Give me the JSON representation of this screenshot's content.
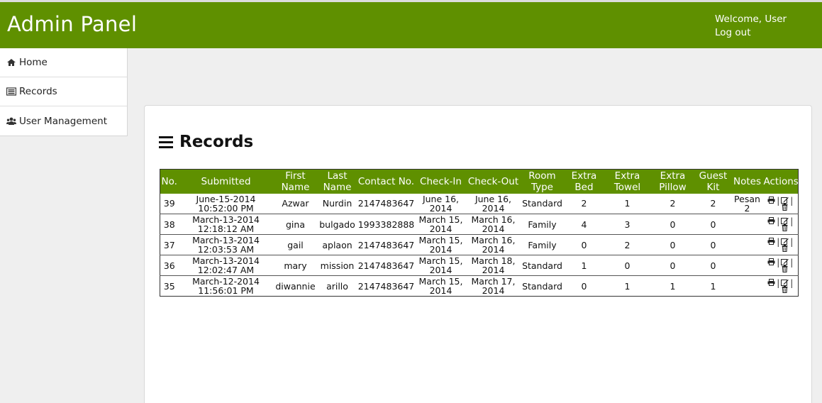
{
  "header": {
    "title": "Admin Panel",
    "welcome": "Welcome, User",
    "logout": "Log out"
  },
  "sidebar": {
    "items": [
      {
        "label": "Home",
        "icon": "home-icon"
      },
      {
        "label": "Records",
        "icon": "list-icon"
      },
      {
        "label": "User Management",
        "icon": "users-icon"
      }
    ]
  },
  "main": {
    "title": "Records"
  },
  "table": {
    "headers": [
      "No.",
      "Submitted",
      "First Name",
      "Last Name",
      "Contact No.",
      "Check-In",
      "Check-Out",
      "Room Type",
      "Extra Bed",
      "Extra Towel",
      "Extra Pillow",
      "Guest Kit",
      "Notes",
      "Actions"
    ],
    "rows": [
      {
        "no": "39",
        "submitted_date": "June-15-2014",
        "submitted_time": "10:52:00 PM",
        "first": "Azwar",
        "last": "Nurdin",
        "contact": "2147483647",
        "checkin": "June 16, 2014",
        "checkout": "June 16, 2014",
        "room": "Standard",
        "bed": "2",
        "towel": "1",
        "pillow": "2",
        "kit": "2",
        "notes": "Pesan 2"
      },
      {
        "no": "38",
        "submitted_date": "March-13-2014",
        "submitted_time": "12:18:12 AM",
        "first": "gina",
        "last": "bulgado",
        "contact": "1993382888",
        "checkin": "March 15, 2014",
        "checkout": "March 16, 2014",
        "room": "Family",
        "bed": "4",
        "towel": "3",
        "pillow": "0",
        "kit": "0",
        "notes": ""
      },
      {
        "no": "37",
        "submitted_date": "March-13-2014",
        "submitted_time": "12:03:53 AM",
        "first": "gail",
        "last": "aplaon",
        "contact": "2147483647",
        "checkin": "March 15, 2014",
        "checkout": "March 16, 2014",
        "room": "Family",
        "bed": "0",
        "towel": "2",
        "pillow": "0",
        "kit": "0",
        "notes": ""
      },
      {
        "no": "36",
        "submitted_date": "March-13-2014",
        "submitted_time": "12:02:47 AM",
        "first": "mary",
        "last": "mission",
        "contact": "2147483647",
        "checkin": "March 15, 2014",
        "checkout": "March 18, 2014",
        "room": "Standard",
        "bed": "1",
        "towel": "0",
        "pillow": "0",
        "kit": "0",
        "notes": ""
      },
      {
        "no": "35",
        "submitted_date": "March-12-2014",
        "submitted_time": "11:56:01 PM",
        "first": "diwannie",
        "last": "arillo",
        "contact": "2147483647",
        "checkin": "March 15, 2014",
        "checkout": "March 17, 2014",
        "room": "Standard",
        "bed": "0",
        "towel": "1",
        "pillow": "1",
        "kit": "1",
        "notes": ""
      }
    ],
    "action_icons": [
      "print-icon",
      "edit-icon",
      "trash-icon"
    ],
    "separator": "|"
  },
  "colors": {
    "header_bg": "#5f9000",
    "table_header_bg": "#5f9000",
    "page_bg": "#efefef"
  }
}
